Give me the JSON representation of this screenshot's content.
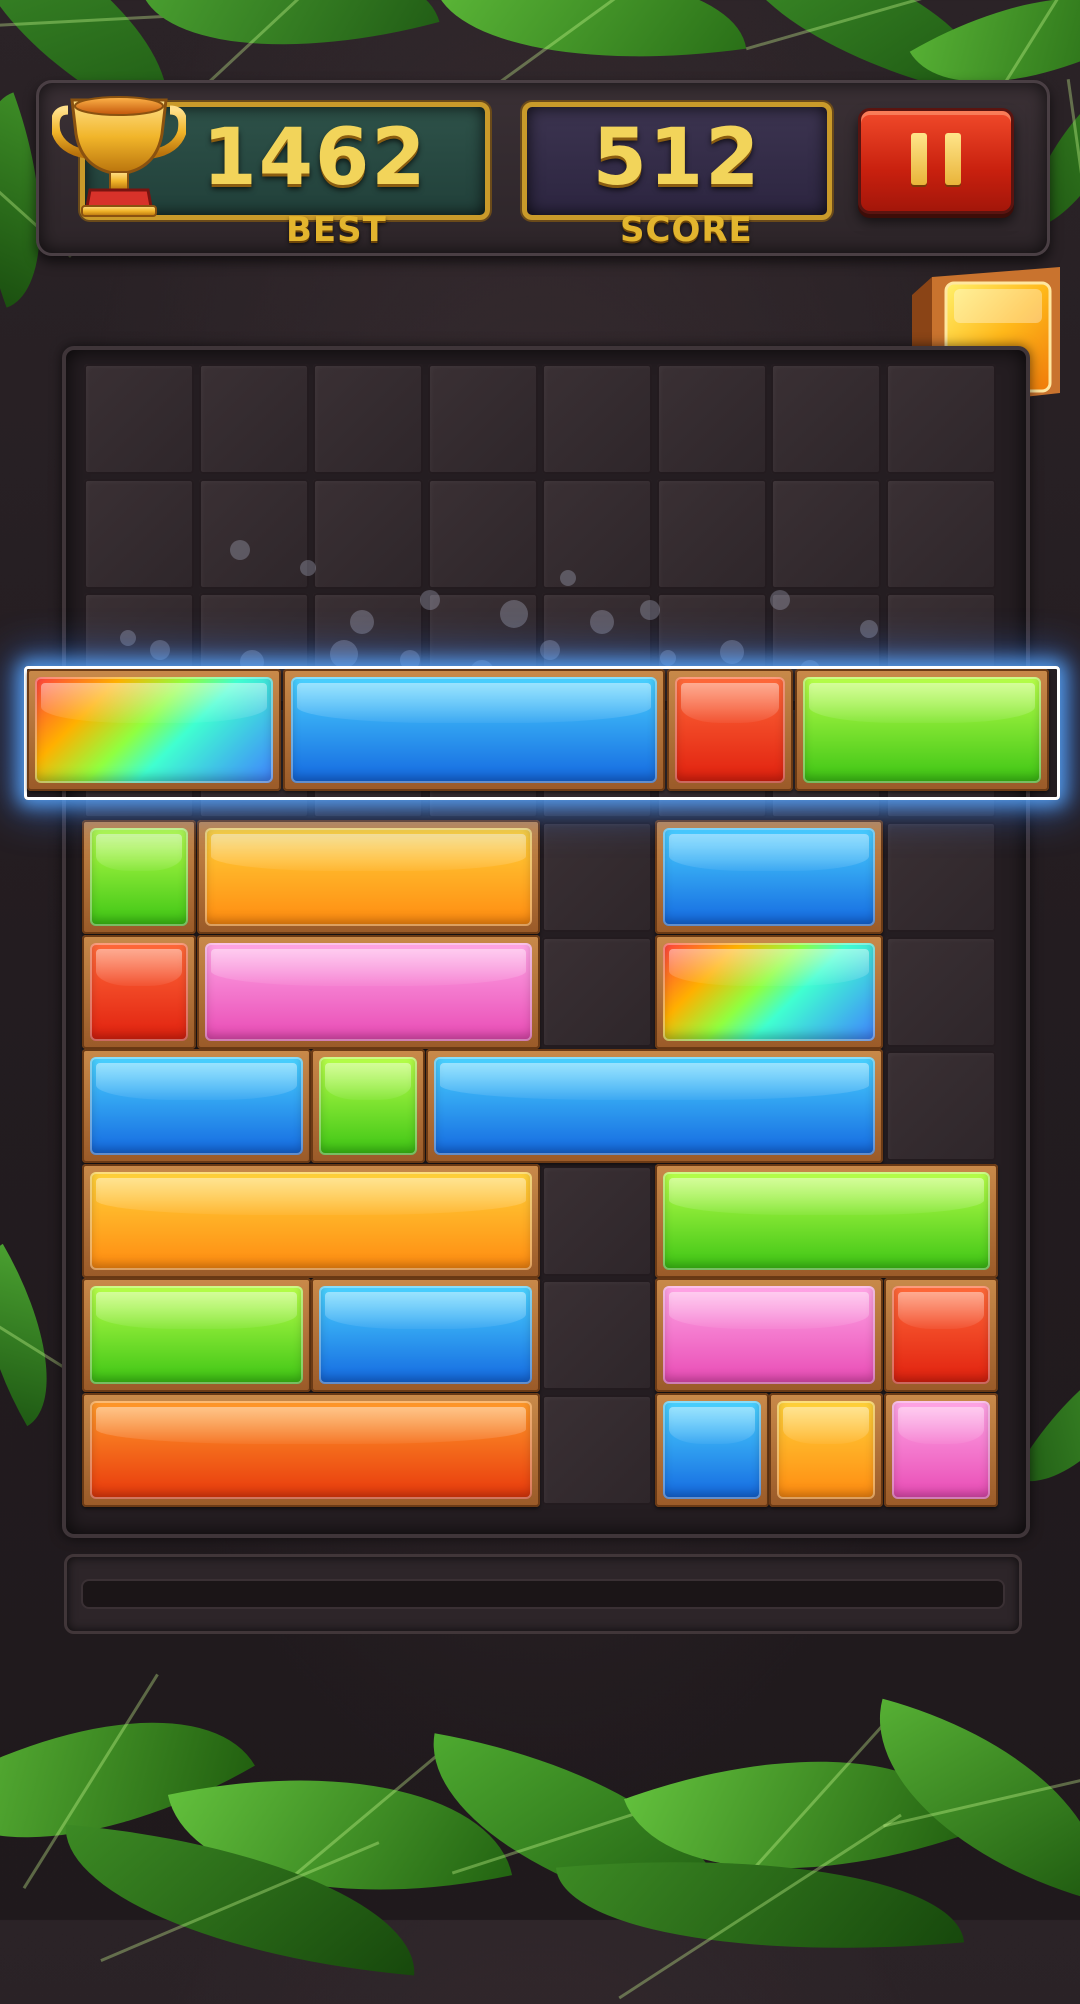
{
  "header": {
    "best_value": "1462",
    "best_label": "BEST",
    "score_value": "512",
    "score_label": "SCORE"
  },
  "icons": {
    "trophy": "trophy-icon",
    "pause": "pause-icon",
    "next_block": "next-block-icon"
  },
  "colors": {
    "red": [
      "#ff6a3a",
      "#e0200e"
    ],
    "orange": [
      "#ffd23a",
      "#ff8a10"
    ],
    "orange_red": [
      "#ff9a2a",
      "#e8380c"
    ],
    "green": [
      "#b8ff4a",
      "#3cc414"
    ],
    "blue": [
      "#4ad2ff",
      "#1468e0"
    ],
    "pink": [
      "#ffa6e6",
      "#e84ab4"
    ],
    "rainbow": [
      "#ff4040",
      "#40ffd0",
      "#4080ff"
    ]
  },
  "board": {
    "columns": 8,
    "rows": 10,
    "highlighted_row": [
      {
        "col": 0,
        "span": 2,
        "color": "rainbow"
      },
      {
        "col": 2,
        "span": 3,
        "color": "blue"
      },
      {
        "col": 5,
        "span": 1,
        "color": "red"
      },
      {
        "col": 6,
        "span": 2,
        "color": "green"
      }
    ],
    "placed_rows": [
      {
        "row": 4,
        "blocks": [
          {
            "col": 0,
            "span": 1,
            "color": "green"
          },
          {
            "col": 1,
            "span": 3,
            "color": "orange"
          },
          {
            "col": 5,
            "span": 2,
            "color": "blue"
          }
        ]
      },
      {
        "row": 5,
        "blocks": [
          {
            "col": 0,
            "span": 1,
            "color": "red"
          },
          {
            "col": 1,
            "span": 3,
            "color": "pink"
          },
          {
            "col": 5,
            "span": 2,
            "color": "rainbow"
          }
        ]
      },
      {
        "row": 6,
        "blocks": [
          {
            "col": 0,
            "span": 2,
            "color": "blue"
          },
          {
            "col": 2,
            "span": 1,
            "color": "green"
          },
          {
            "col": 3,
            "span": 4,
            "color": "blue"
          }
        ]
      },
      {
        "row": 7,
        "blocks": [
          {
            "col": 0,
            "span": 4,
            "color": "orange"
          },
          {
            "col": 5,
            "span": 3,
            "color": "green"
          }
        ]
      },
      {
        "row": 8,
        "blocks": [
          {
            "col": 0,
            "span": 2,
            "color": "green"
          },
          {
            "col": 2,
            "span": 2,
            "color": "blue"
          },
          {
            "col": 5,
            "span": 2,
            "color": "pink"
          },
          {
            "col": 7,
            "span": 1,
            "color": "red"
          }
        ]
      },
      {
        "row": 9,
        "blocks": [
          {
            "col": 0,
            "span": 4,
            "color": "orange_red"
          },
          {
            "col": 5,
            "span": 1,
            "color": "blue"
          },
          {
            "col": 6,
            "span": 1,
            "color": "orange"
          },
          {
            "col": 7,
            "span": 1,
            "color": "pink"
          }
        ]
      }
    ]
  }
}
